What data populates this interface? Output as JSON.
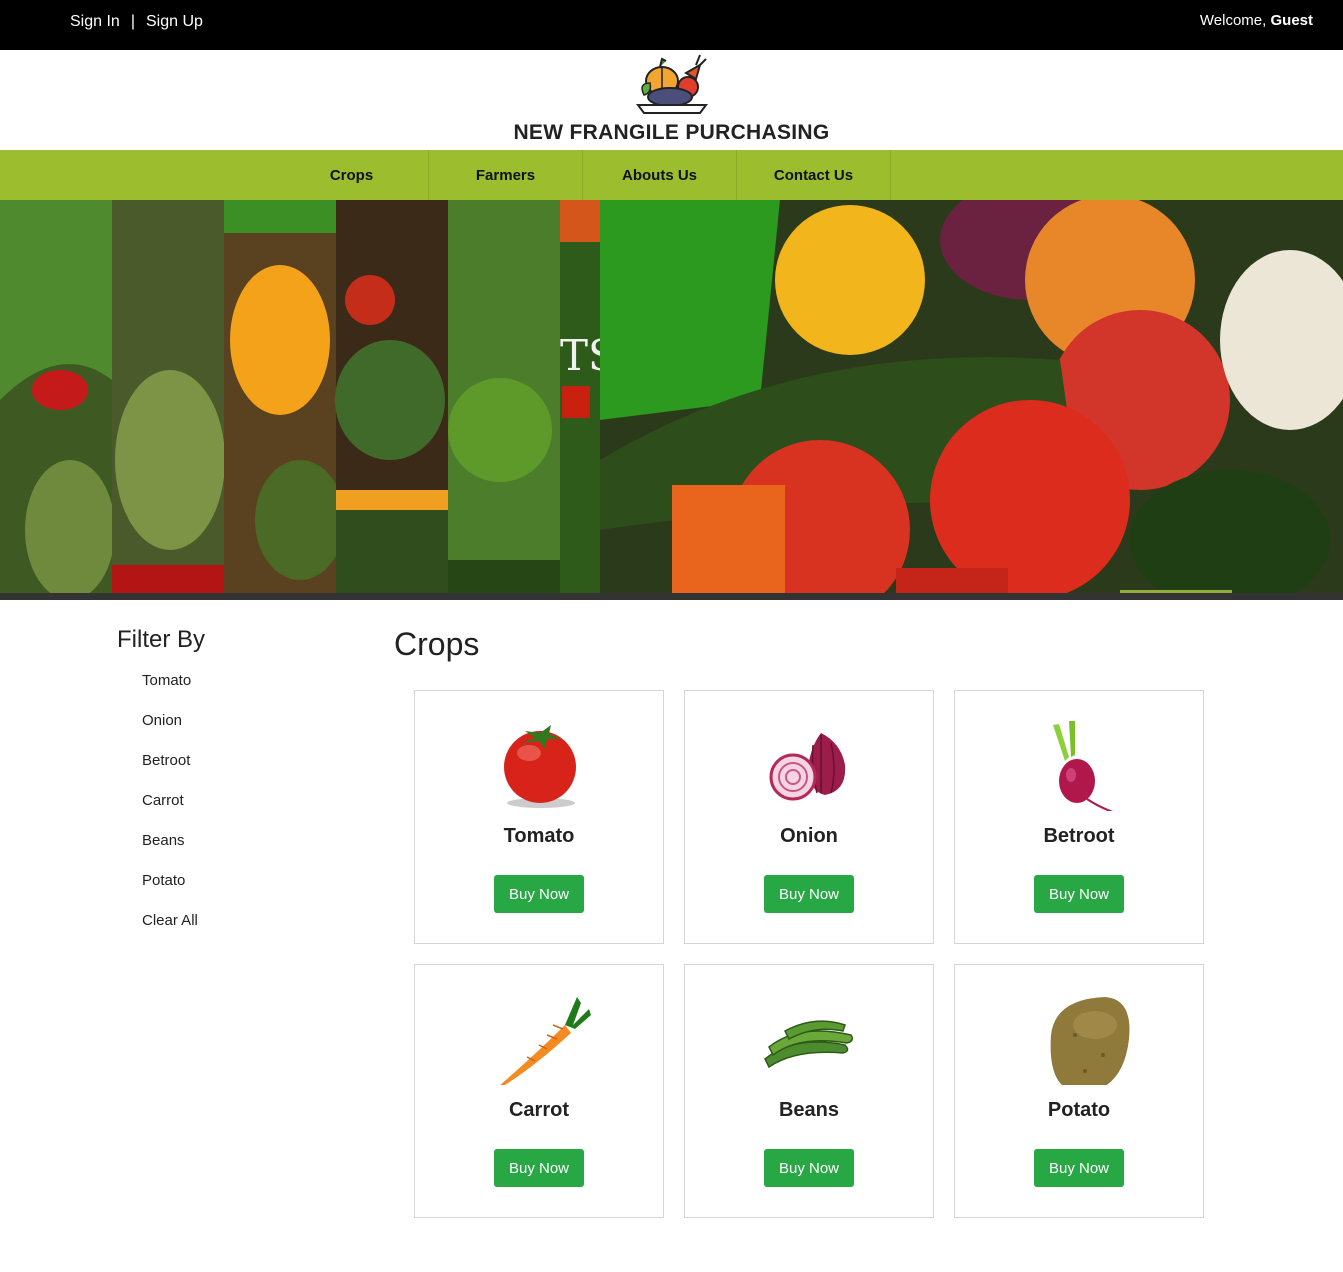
{
  "topbar": {
    "sign_in": "Sign In",
    "separator": "|",
    "sign_up": "Sign Up",
    "welcome_prefix": "Welcome,",
    "welcome_user": "Guest"
  },
  "header": {
    "brand": "NEW FRANGILE PURCHASING"
  },
  "nav": {
    "items": [
      "Crops",
      "Farmers",
      "Abouts Us",
      "Contact Us"
    ]
  },
  "hero": {
    "overlay_text": "TS"
  },
  "sidebar": {
    "title": "Filter By",
    "items": [
      "Tomato",
      "Onion",
      "Betroot",
      "Carrot",
      "Beans",
      "Potato",
      "Clear All"
    ]
  },
  "main": {
    "title": "Crops",
    "cards": [
      {
        "name": "Tomato",
        "button": "Buy Now"
      },
      {
        "name": "Onion",
        "button": "Buy Now"
      },
      {
        "name": "Betroot",
        "button": "Buy Now"
      },
      {
        "name": "Carrot",
        "button": "Buy Now"
      },
      {
        "name": "Beans",
        "button": "Buy Now"
      },
      {
        "name": "Potato",
        "button": "Buy Now"
      }
    ]
  },
  "colors": {
    "topbar": "#000000",
    "nav": "#9bbd2e",
    "buy_button": "#28a745"
  }
}
